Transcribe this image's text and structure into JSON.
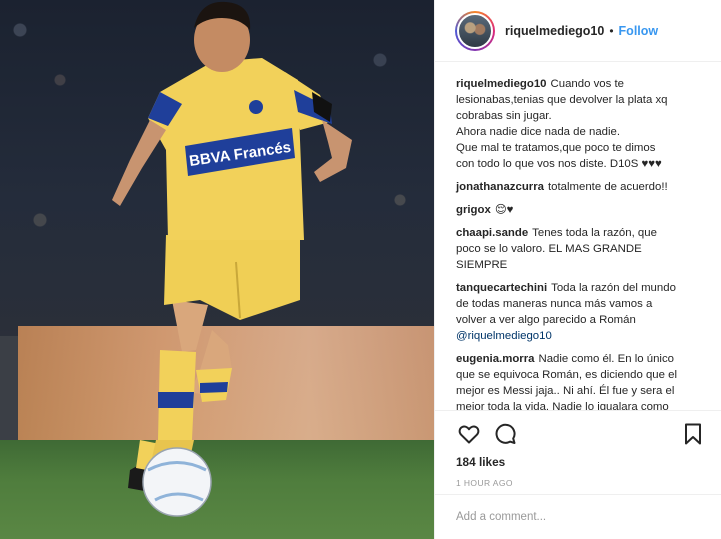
{
  "post": {
    "username": "riquelmediego10",
    "follow_label": "Follow",
    "header_dot": "•",
    "shirt_text": "BBVA Francés"
  },
  "caption": {
    "username": "riquelmediego10",
    "lines": [
      "Cuando vos te",
      "lesionabas,tenias que devolver la plata xq",
      "cobrabas sin jugar.",
      "Ahora nadie dice nada de nadie.",
      "Que mal te tratamos,que poco te dimos",
      "con todo lo que vos nos diste. D10S ♥♥♥"
    ]
  },
  "comments": [
    {
      "username": "jonathanazcurra",
      "lines": [
        "totalmente de acuerdo!!"
      ]
    },
    {
      "username": "grigox",
      "lines": [
        "😌♥"
      ]
    },
    {
      "username": "chaapi.sande",
      "lines": [
        "Tenes toda la razón, que",
        "poco se lo valoro. EL MAS GRANDE",
        "SIEMPRE"
      ]
    },
    {
      "username": "tanquecartechini",
      "lines": [
        "Toda la razón del mundo",
        "de todas maneras nunca más vamos a",
        "volver a ver algo parecido a Román"
      ],
      "mention": "@riquelmediego10"
    },
    {
      "username": "eugenia.morra",
      "lines": [
        "Nadie como él. En lo único",
        "que se equivoca Román, es diciendo que el",
        "mejor es Messi jaja.. Ni ahí. Él fue y sera el",
        "mejor toda la vida. Nadie lo igualara como"
      ]
    }
  ],
  "actions": {
    "like_icon": "heart-icon",
    "comment_icon": "comment-bubble-icon",
    "save_icon": "bookmark-icon",
    "likes_text": "184 likes",
    "timestamp": "1 HOUR AGO"
  },
  "add_comment": {
    "placeholder": "Add a comment..."
  },
  "colors": {
    "follow": "#3897f0",
    "shirt_yellow": "#f2d15a",
    "shirt_blue": "#1f3f9a"
  }
}
